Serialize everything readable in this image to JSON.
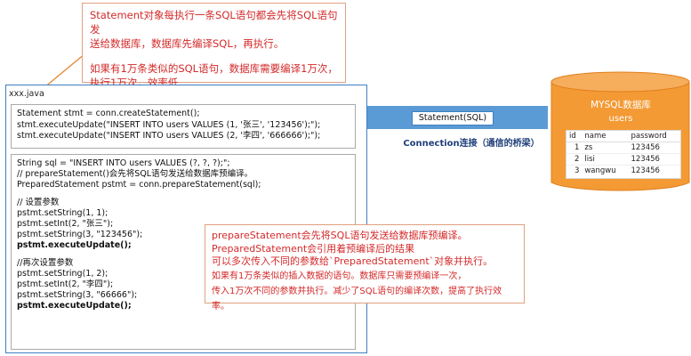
{
  "top_note": {
    "line1": "Statement对象每执行一条SQL语句都会先将SQL语句发",
    "line2": "送给数据库，数据库先编译SQL，再执行。",
    "line3": "如果有1万条类似的SQL语句，数据库需要编译1万次，",
    "line4": "执行1万次，效率低"
  },
  "java": {
    "title": "xxx.java",
    "block1": [
      "Statement stmt = conn.createStatement();",
      "stmt.executeUpdate(\"INSERT INTO users VALUES (1, '张三', '123456');\");",
      "stmt.executeUpdate(\"INSERT INTO users VALUES (2, '李四', '666666');\");"
    ],
    "block2": {
      "head": [
        "String sql = \"INSERT INTO users VALUES (?, ?, ?);\";",
        "// prepareStatement()会先将SQL语句发送给数据库预编译。",
        "PreparedStatement pstmt = conn.prepareStatement(sql);"
      ],
      "set1": [
        "// 设置参数",
        "pstmt.setString(1, 1);",
        "pstmt.setInt(2, \"张三\");",
        "pstmt.setString(3, \"123456\");"
      ],
      "exec1": "pstmt.executeUpdate();",
      "set2": [
        "//再次设置参数",
        "pstmt.setString(1, 2);",
        "pstmt.setInt(2, \"李四\");",
        "pstmt.setString(3, \"66666\");"
      ],
      "exec2": "pstmt.executeUpdate();"
    }
  },
  "mid_note": {
    "line1": "prepareStatement会先将SQL语句发送给数据库预编译。",
    "line2": "PreparedStatement会引用着预编译后的结果",
    "line3": "可以多次传入不同的参数给`PreparedStatement`对象并执行。",
    "line4": "如果有1万条类似的插入数据的语句。数据库只需要预编译一次，",
    "line5": "传入1万次不同的参数并执行。减少了SQL语句的编译次数，提高了执行效率。"
  },
  "connection": {
    "statement_label": "Statement(SQL)",
    "label": "Connection连接（通信的桥梁）"
  },
  "database": {
    "title": "MYSQL数据库",
    "table_name": "users",
    "columns": [
      "id",
      "name",
      "password"
    ],
    "rows": [
      [
        "1",
        "zs",
        "123456"
      ],
      [
        "2",
        "lisi",
        "123456"
      ],
      [
        "3",
        "wangwu",
        "123456"
      ]
    ]
  },
  "colors": {
    "note_text": "#d42a2a",
    "panel_border": "#3f7fc4",
    "connection_band": "#5b9bd5",
    "database_fill": "#f39a34"
  }
}
